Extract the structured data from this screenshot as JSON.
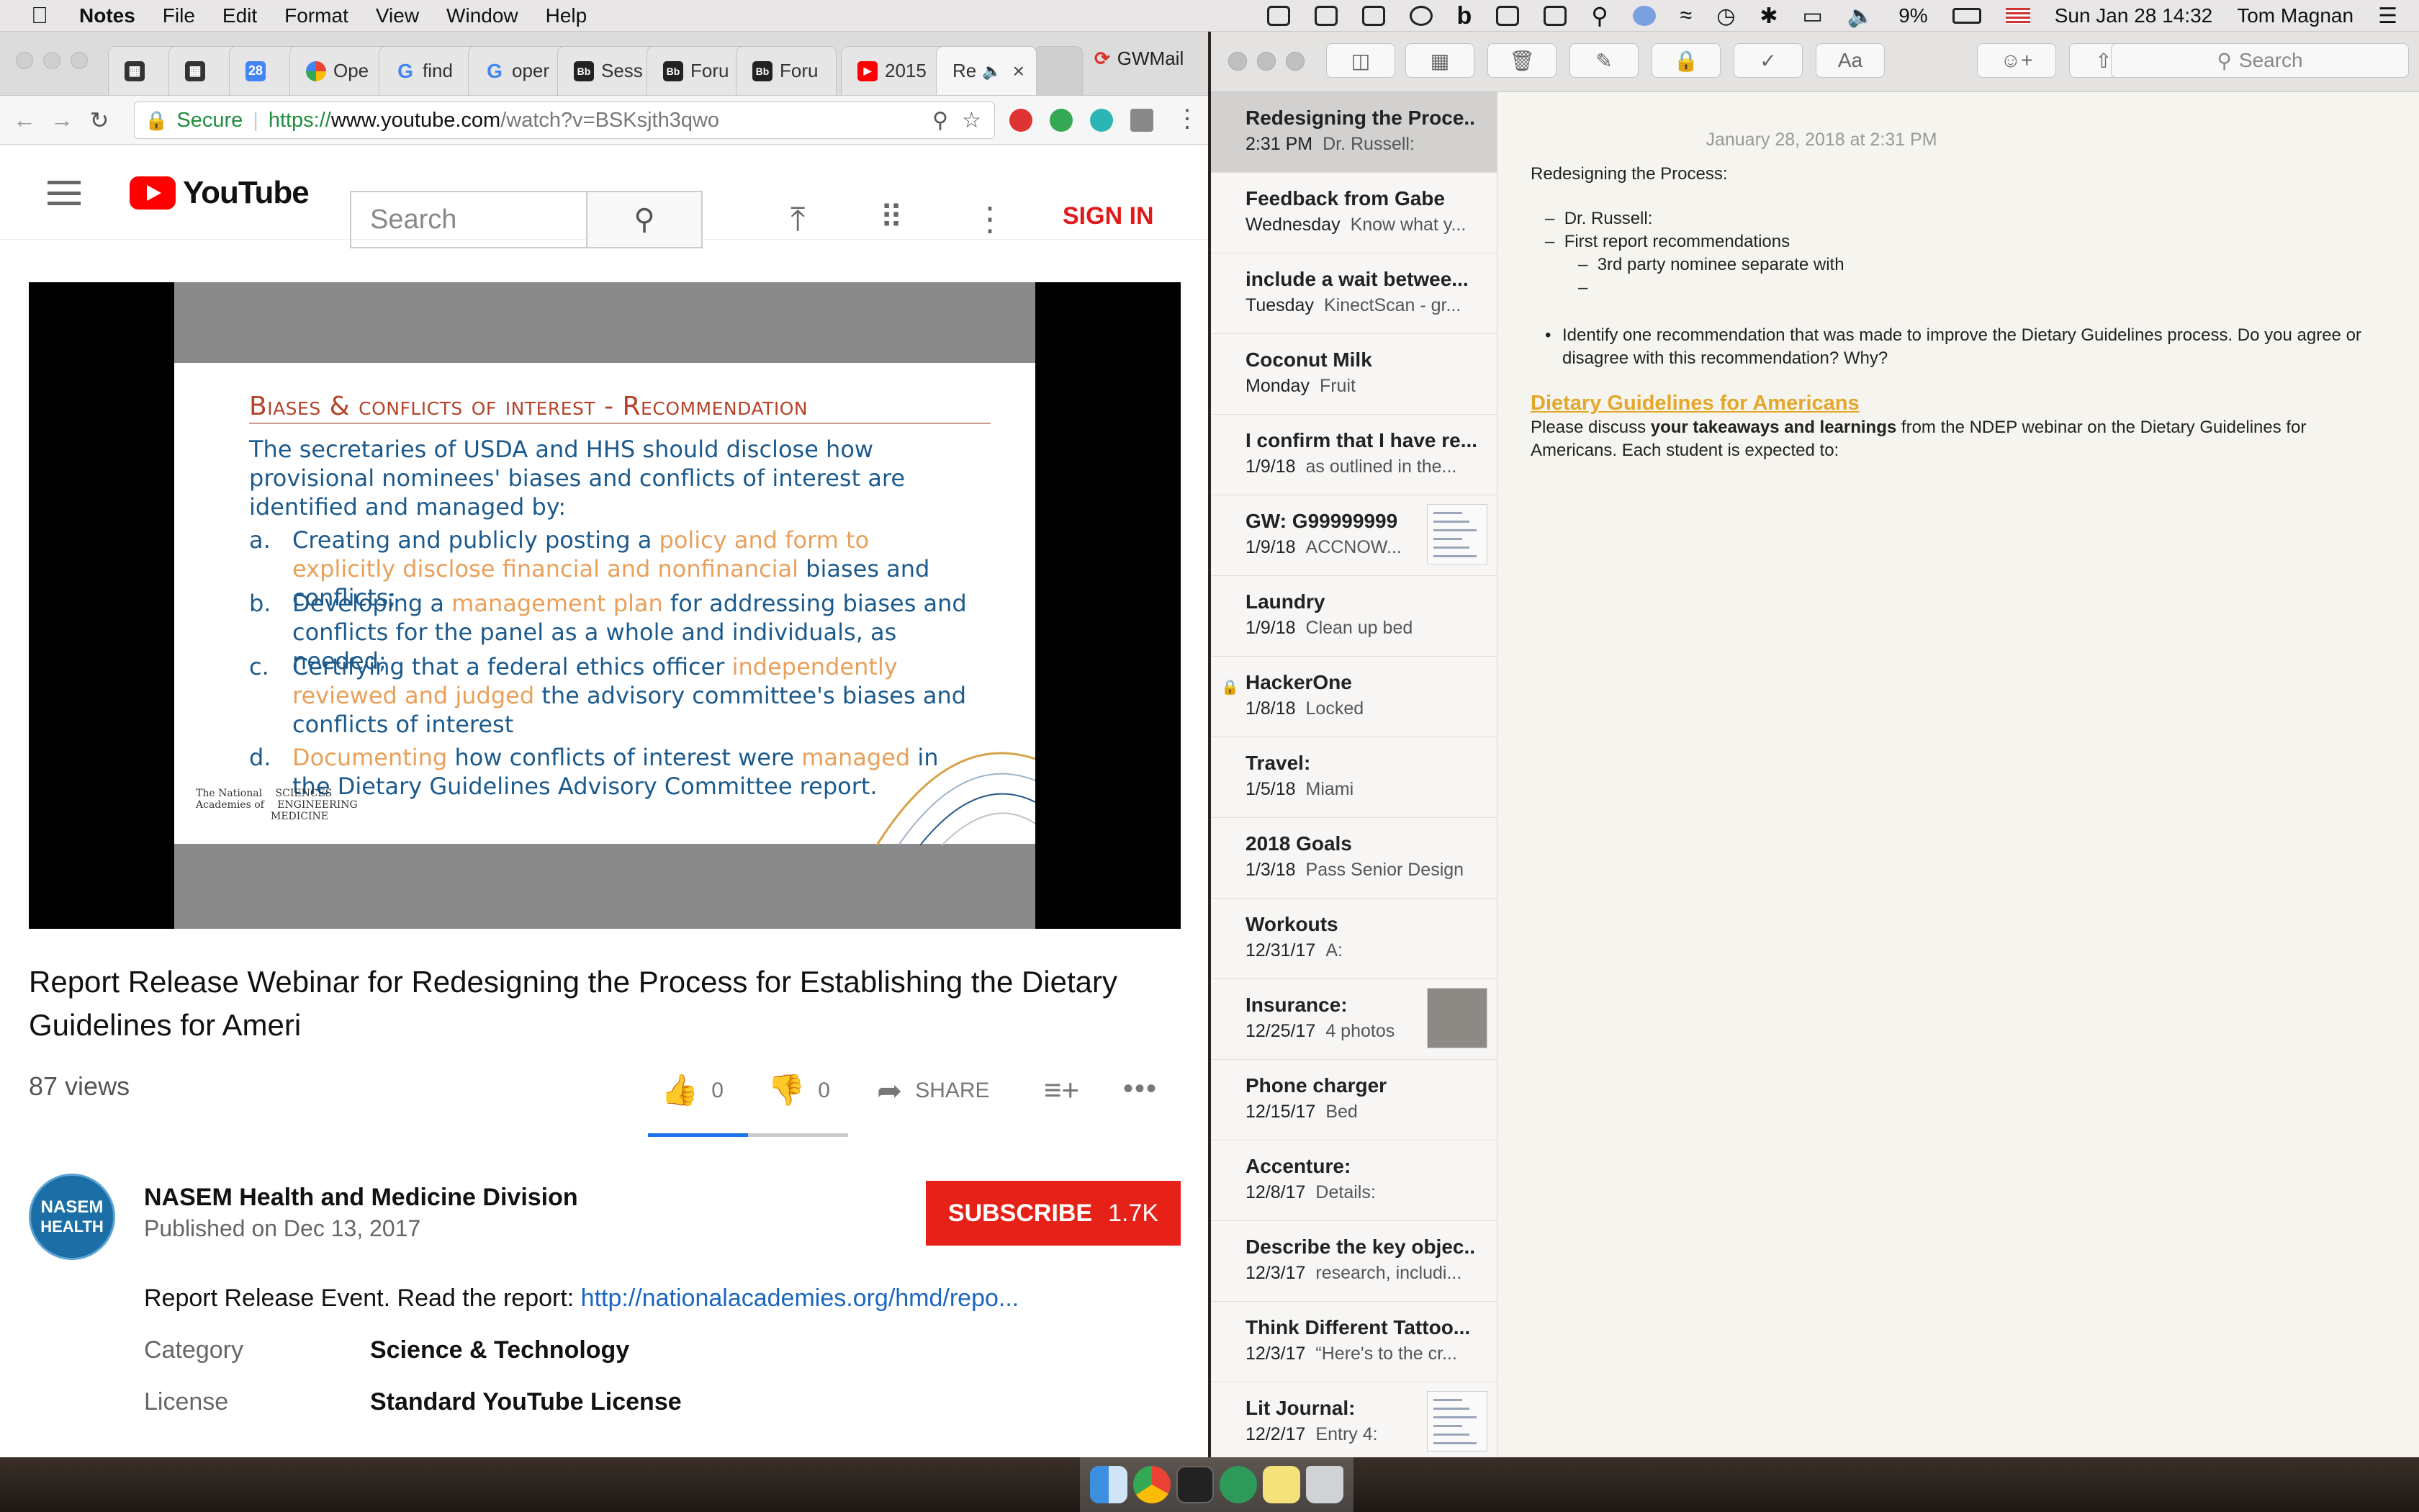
{
  "menubar": {
    "app_name": "Notes",
    "menus": [
      "File",
      "Edit",
      "Format",
      "View",
      "Window",
      "Help"
    ],
    "battery": "9%",
    "datetime": "Sun Jan 28  14:32",
    "user": "Tom Magnan"
  },
  "browser": {
    "tabs": [
      {
        "label": "",
        "icon": "trello-icon"
      },
      {
        "label": "",
        "icon": "trello-icon"
      },
      {
        "label": "",
        "icon": "calendar-icon"
      },
      {
        "label": "Ope",
        "icon": "google-photos-icon"
      },
      {
        "label": "find",
        "icon": "google-icon"
      },
      {
        "label": "oper",
        "icon": "google-icon"
      },
      {
        "label": "Sess",
        "icon": "blackboard-icon"
      },
      {
        "label": "Foru",
        "icon": "blackboard-icon"
      },
      {
        "label": "Foru",
        "icon": "blackboard-icon"
      },
      {
        "label": "2015",
        "icon": "youtube-icon"
      },
      {
        "label": "Re",
        "icon": "speaker-icon"
      }
    ],
    "extra_tab": "GWMail",
    "secure_label": "Secure",
    "url_scheme": "https://",
    "url_host": "www.youtube.com",
    "url_path": "/watch?v=BSKsjth3qwo"
  },
  "youtube": {
    "logo_text": "YouTube",
    "search_placeholder": "Search",
    "sign_in": "SIGN IN",
    "slide": {
      "title": "Biases & conflicts of interest - Recommendation",
      "intro": "The secretaries of USDA and HHS should disclose how provisional nominees' biases and conflicts of interest are identified and managed by:",
      "items": [
        {
          "letter": "a.",
          "parts": [
            "Creating and publicly posting a ",
            "policy and form to explicitly disclose financial and nonfinancial",
            " biases and conflicts;"
          ]
        },
        {
          "letter": "b.",
          "parts": [
            "Developing a ",
            "management plan",
            " for addressing biases and conflicts for the panel as a whole and individuals, as needed;"
          ]
        },
        {
          "letter": "c.",
          "parts": [
            "Certifying that a federal ethics officer ",
            "independently reviewed and judged",
            " the advisory committee's biases and conflicts of interest"
          ]
        },
        {
          "letter": "d.",
          "parts": [
            "",
            "Documenting",
            " how conflicts of interest were ",
            "managed",
            " in the Dietary Guidelines Advisory Committee report."
          ]
        }
      ],
      "logo_lines": [
        "The National",
        "Academies of",
        "SCIENCES",
        "ENGINEERING",
        "MEDICINE"
      ]
    },
    "video_title": "Report Release Webinar for Redesigning the Process for Establishing the Dietary Guidelines for Ameri",
    "views": "87 views",
    "likes": "0",
    "dislikes": "0",
    "like_ratio": 0.5,
    "share_label": "SHARE",
    "channel": {
      "avatar_line1": "NASEM",
      "avatar_line2": "HEALTH",
      "name": "NASEM Health and Medicine Division",
      "published": "Published on Dec 13, 2017"
    },
    "subscribe_label": "SUBSCRIBE",
    "subscriber_count": "1.7K",
    "description_text": "Report Release Event. Read the report: ",
    "description_link": "http://nationalacademies.org/hmd/repo...",
    "meta": [
      {
        "key": "Category",
        "value": "Science & Technology"
      },
      {
        "key": "License",
        "value": "Standard YouTube License"
      }
    ]
  },
  "notes": {
    "search_placeholder": "Search",
    "list": [
      {
        "title": "Redesigning the Proce...",
        "date": "2:31 PM",
        "preview": "Dr. Russell:"
      },
      {
        "title": "Feedback from Gabe",
        "date": "Wednesday",
        "preview": "Know what y..."
      },
      {
        "title": "include a wait betwee...",
        "date": "Tuesday",
        "preview": "KinectScan - gr..."
      },
      {
        "title": "Coconut Milk",
        "date": "Monday",
        "preview": "Fruit"
      },
      {
        "title": "I confirm that I have re...",
        "date": "1/9/18",
        "preview": "as outlined in the..."
      },
      {
        "title": "GW: G99999999",
        "date": "1/9/18",
        "preview": "ACCNOW..."
      },
      {
        "title": "Laundry",
        "date": "1/9/18",
        "preview": "Clean up bed"
      },
      {
        "title": "HackerOne",
        "date": "1/8/18",
        "preview": "Locked"
      },
      {
        "title": "Travel:",
        "date": "1/5/18",
        "preview": "Miami"
      },
      {
        "title": "2018 Goals",
        "date": "1/3/18",
        "preview": "Pass Senior Design"
      },
      {
        "title": "Workouts",
        "date": "12/31/17",
        "preview": "A:"
      },
      {
        "title": "Insurance:",
        "date": "12/25/17",
        "preview": "4 photos"
      },
      {
        "title": "Phone charger",
        "date": "12/15/17",
        "preview": "Bed"
      },
      {
        "title": "Accenture:",
        "date": "12/8/17",
        "preview": "Details:"
      },
      {
        "title": "Describe the key objec...",
        "date": "12/3/17",
        "preview": "research, includi..."
      },
      {
        "title": "Think Different Tattoo...",
        "date": "12/3/17",
        "preview": "“Here's to the cr..."
      },
      {
        "title": "Lit Journal:",
        "date": "12/2/17",
        "preview": "Entry 4:"
      }
    ],
    "body": {
      "date": "January 28, 2018 at 2:31 PM",
      "heading": "Redesigning the Process:",
      "bullet1": "Dr. Russell:",
      "bullet2": "First report recommendations",
      "sub1": "3rd party nominee separate with",
      "sub2": "",
      "question": "Identify one recommendation that was made to improve the Dietary Guidelines process. Do you agree or disagree with this recommendation? Why?",
      "link": "Dietary Guidelines for Americans",
      "para_pre": "Please discuss ",
      "para_bold": "your takeaways and learnings",
      "para_post": " from the NDEP webinar on the Dietary Guidelines for",
      "para_line2": "Americans. Each student is expected to:"
    }
  }
}
